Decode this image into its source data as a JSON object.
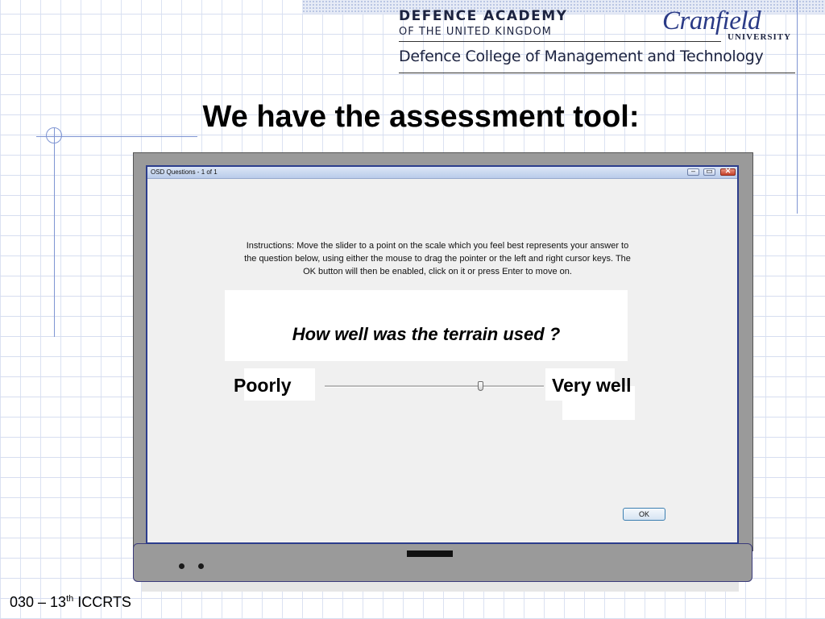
{
  "header": {
    "org_line1": "DEFENCE ACADEMY",
    "org_line2": "OF THE UNITED KINGDOM",
    "logo_name": "Cranfield",
    "logo_sub": "UNIVERSITY",
    "college": "Defence College of Management and Technology"
  },
  "slide": {
    "title": "We have the assessment tool:"
  },
  "window": {
    "title": "OSD Questions - 1 of 1",
    "minimize_glyph": "–",
    "maximize_glyph": "▭",
    "close_glyph": "✕"
  },
  "content": {
    "instructions": "Instructions: Move the slider to a point on the scale which you feel best represents your answer to the question below, using either the mouse to drag the pointer or the left and right cursor keys. The OK button will then be enabled, click on it or press Enter to move on.",
    "question": "How well was the terrain used ?",
    "scale_low": "Poorly",
    "scale_high": "Very well",
    "slider_value": 0.71,
    "ok_label": "OK"
  },
  "footer": {
    "prefix": "030 – 13",
    "superscript": "th",
    "suffix": " ICCRTS"
  },
  "colors": {
    "window_border": "#2c3d8c",
    "monitor_frame": "#9a9a9a",
    "accent_blue": "#2a3a86"
  }
}
